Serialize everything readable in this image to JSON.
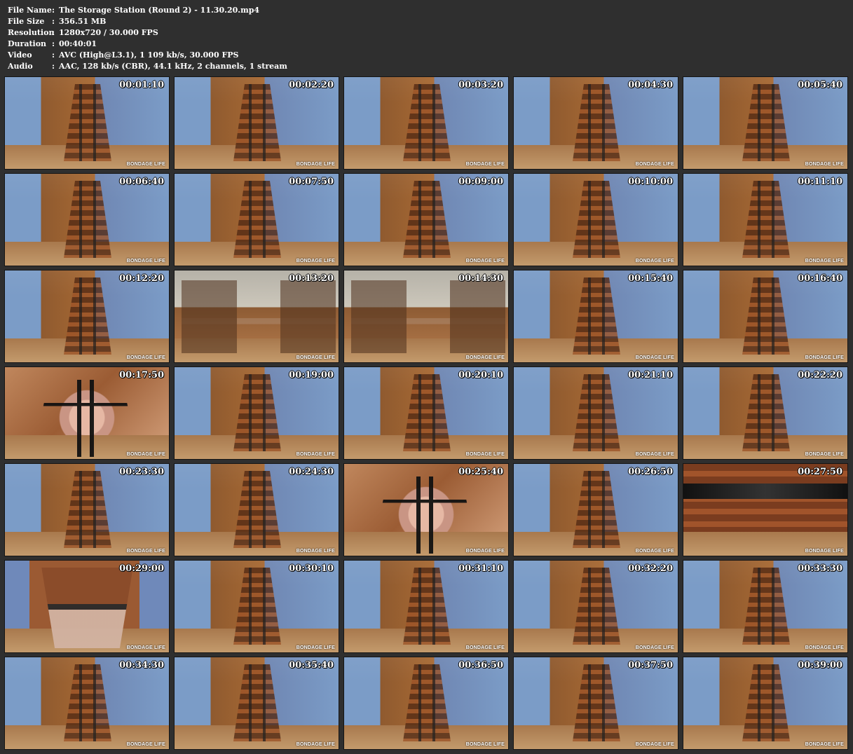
{
  "meta": {
    "file_name_label": "File Name",
    "file_name_value": "The Storage Station (Round 2) - 11.30.20.mp4",
    "file_size_label": "File Size",
    "file_size_value": "356.51 MB",
    "resolution_label": "Resolution",
    "resolution_value": "1280x720 / 30.000 FPS",
    "duration_label": "Duration",
    "duration_value": "00:40:01",
    "video_label": "Video",
    "video_value": "AVC (High@L3.1), 1 109 kb/s, 30.000 FPS",
    "audio_label": "Audio",
    "audio_value": "AAC, 128 kb/s (CBR), 44.1 kHz, 2 channels, 1 stream",
    "separator": ":"
  },
  "thumbnails": [
    {
      "time": "00:01:10",
      "watermark": "BONDAGE LIFE"
    },
    {
      "time": "00:02:20",
      "watermark": "BONDAGE LIFE"
    },
    {
      "time": "00:03:20",
      "watermark": "BONDAGE LIFE"
    },
    {
      "time": "00:04:30",
      "watermark": "BONDAGE LIFE"
    },
    {
      "time": "00:05:40",
      "watermark": "BONDAGE LIFE"
    },
    {
      "time": "00:06:40",
      "watermark": "BONDAGE LIFE"
    },
    {
      "time": "00:07:50",
      "watermark": "BONDAGE LIFE"
    },
    {
      "time": "00:09:00",
      "watermark": "BONDAGE LIFE"
    },
    {
      "time": "00:10:00",
      "watermark": "BONDAGE LIFE"
    },
    {
      "time": "00:11:10",
      "watermark": "BONDAGE LIFE"
    },
    {
      "time": "00:12:20",
      "watermark": "BONDAGE LIFE"
    },
    {
      "time": "00:13:20",
      "watermark": "BONDAGE LIFE"
    },
    {
      "time": "00:14:30",
      "watermark": "BONDAGE LIFE"
    },
    {
      "time": "00:15:40",
      "watermark": "BONDAGE LIFE"
    },
    {
      "time": "00:16:40",
      "watermark": "BONDAGE LIFE"
    },
    {
      "time": "00:17:50",
      "watermark": "BONDAGE LIFE"
    },
    {
      "time": "00:19:00",
      "watermark": "BONDAGE LIFE"
    },
    {
      "time": "00:20:10",
      "watermark": "BONDAGE LIFE"
    },
    {
      "time": "00:21:10",
      "watermark": "BONDAGE LIFE"
    },
    {
      "time": "00:22:20",
      "watermark": "BONDAGE LIFE"
    },
    {
      "time": "00:23:30",
      "watermark": "BONDAGE LIFE"
    },
    {
      "time": "00:24:30",
      "watermark": "BONDAGE LIFE"
    },
    {
      "time": "00:25:40",
      "watermark": "BONDAGE LIFE"
    },
    {
      "time": "00:26:50",
      "watermark": "BONDAGE LIFE"
    },
    {
      "time": "00:27:50",
      "watermark": "BONDAGE LIFE"
    },
    {
      "time": "00:29:00",
      "watermark": "BONDAGE LIFE"
    },
    {
      "time": "00:30:10",
      "watermark": "BONDAGE LIFE"
    },
    {
      "time": "00:31:10",
      "watermark": "BONDAGE LIFE"
    },
    {
      "time": "00:32:20",
      "watermark": "BONDAGE LIFE"
    },
    {
      "time": "00:33:30",
      "watermark": "BONDAGE LIFE"
    },
    {
      "time": "00:34:30",
      "watermark": "BONDAGE LIFE"
    },
    {
      "time": "00:35:40",
      "watermark": "BONDAGE LIFE"
    },
    {
      "time": "00:36:50",
      "watermark": "BONDAGE LIFE"
    },
    {
      "time": "00:37:50",
      "watermark": "BONDAGE LIFE"
    },
    {
      "time": "00:39:00",
      "watermark": "BONDAGE LIFE"
    }
  ]
}
